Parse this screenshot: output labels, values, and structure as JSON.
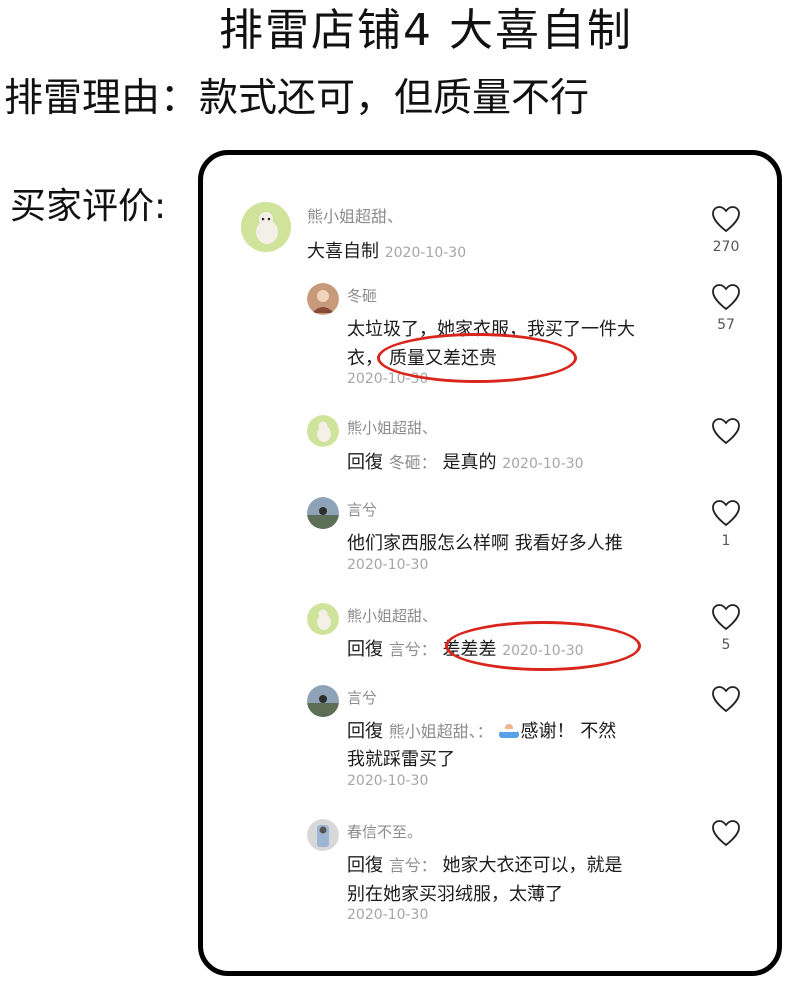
{
  "header": {
    "title": "排雷店铺4  大喜自制",
    "reason": "排雷理由：款式还可，但质量不行",
    "buyer_label": "买家评价:"
  },
  "comments": {
    "c1": {
      "username": "熊小姐超甜、",
      "text": "大喜自制",
      "date": "2020-10-30",
      "likes": "270"
    },
    "c2": {
      "username": "冬砸",
      "text_line1": "太垃圾了，她家衣服，我买了一件大",
      "text_line2_a": "衣，",
      "text_line2_b": "质量又差还贵",
      "date": "2020-10-30",
      "likes": "57"
    },
    "c3": {
      "username": "熊小姐超甜、",
      "reply_prefix": "回復",
      "reply_target": "冬砸：",
      "text": "是真的",
      "date": "2020-10-30"
    },
    "c4": {
      "username": "言兮",
      "text": "他们家西服怎么样啊 我看好多人推",
      "date": "2020-10-30",
      "likes": "1"
    },
    "c5": {
      "username": "熊小姐超甜、",
      "reply_prefix": "回復",
      "reply_target": "言兮：",
      "text": "差差差",
      "date": "2020-10-30",
      "likes": "5"
    },
    "c6": {
      "username": "言兮",
      "reply_prefix": "回復",
      "reply_target": "熊小姐超甜、：",
      "text_line1": "感谢！ 不然",
      "text_line2": "我就踩雷买了",
      "date": "2020-10-30"
    },
    "c7": {
      "username": "春信不至。",
      "reply_prefix": "回復",
      "reply_target": "言兮：",
      "text_line1": "她家大衣还可以，就是",
      "text_line2": "别在她家买羽绒服，太薄了",
      "date": "2020-10-30"
    }
  },
  "icons": {
    "like": "heart-outline-icon",
    "avatar_bear": "poodle-avatar",
    "emoji": "bathtub-emoji-icon"
  },
  "colors": {
    "highlight_circle": "#d9251c",
    "username": "#8c8c8c",
    "date": "#a6a6a6"
  }
}
